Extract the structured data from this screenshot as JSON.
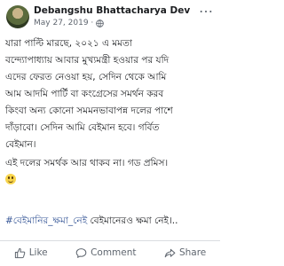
{
  "post": {
    "author": "Debangshu Bhattacharya Dev",
    "date": "May 27, 2019 ·",
    "text_lines": [
      "যারা পাল্টি মারছে, ২০২১ এ মমতা",
      "বন্দ্যোপাধ্যায় আবার মুখ্যমন্ত্রী হওয়ার পর যদি",
      "এদের ফেরত নেওয়া হয়, সেদিন থেকে আমি",
      "আম আদমি পার্টি বা কংগ্রেসের সমর্থন করব",
      "কিংবা অন্য কোনো সমমনভাবাপন্ন দলের পাশে",
      "দাঁড়াবো। সেদিন আমি বেইমান হবে। গর্বিত",
      "বেইমান।"
    ],
    "text_line2_a": "এই দলের সমর্থক আর থাকব না। গড প্রমিস।",
    "hashtag": "#বেইমানির_ক্ষমা_নেই",
    "tags_rest": " বেইমানেরও ক্ষমা নেই।.."
  },
  "actions": {
    "like": "Like",
    "comment": "Comment",
    "share": "Share"
  }
}
